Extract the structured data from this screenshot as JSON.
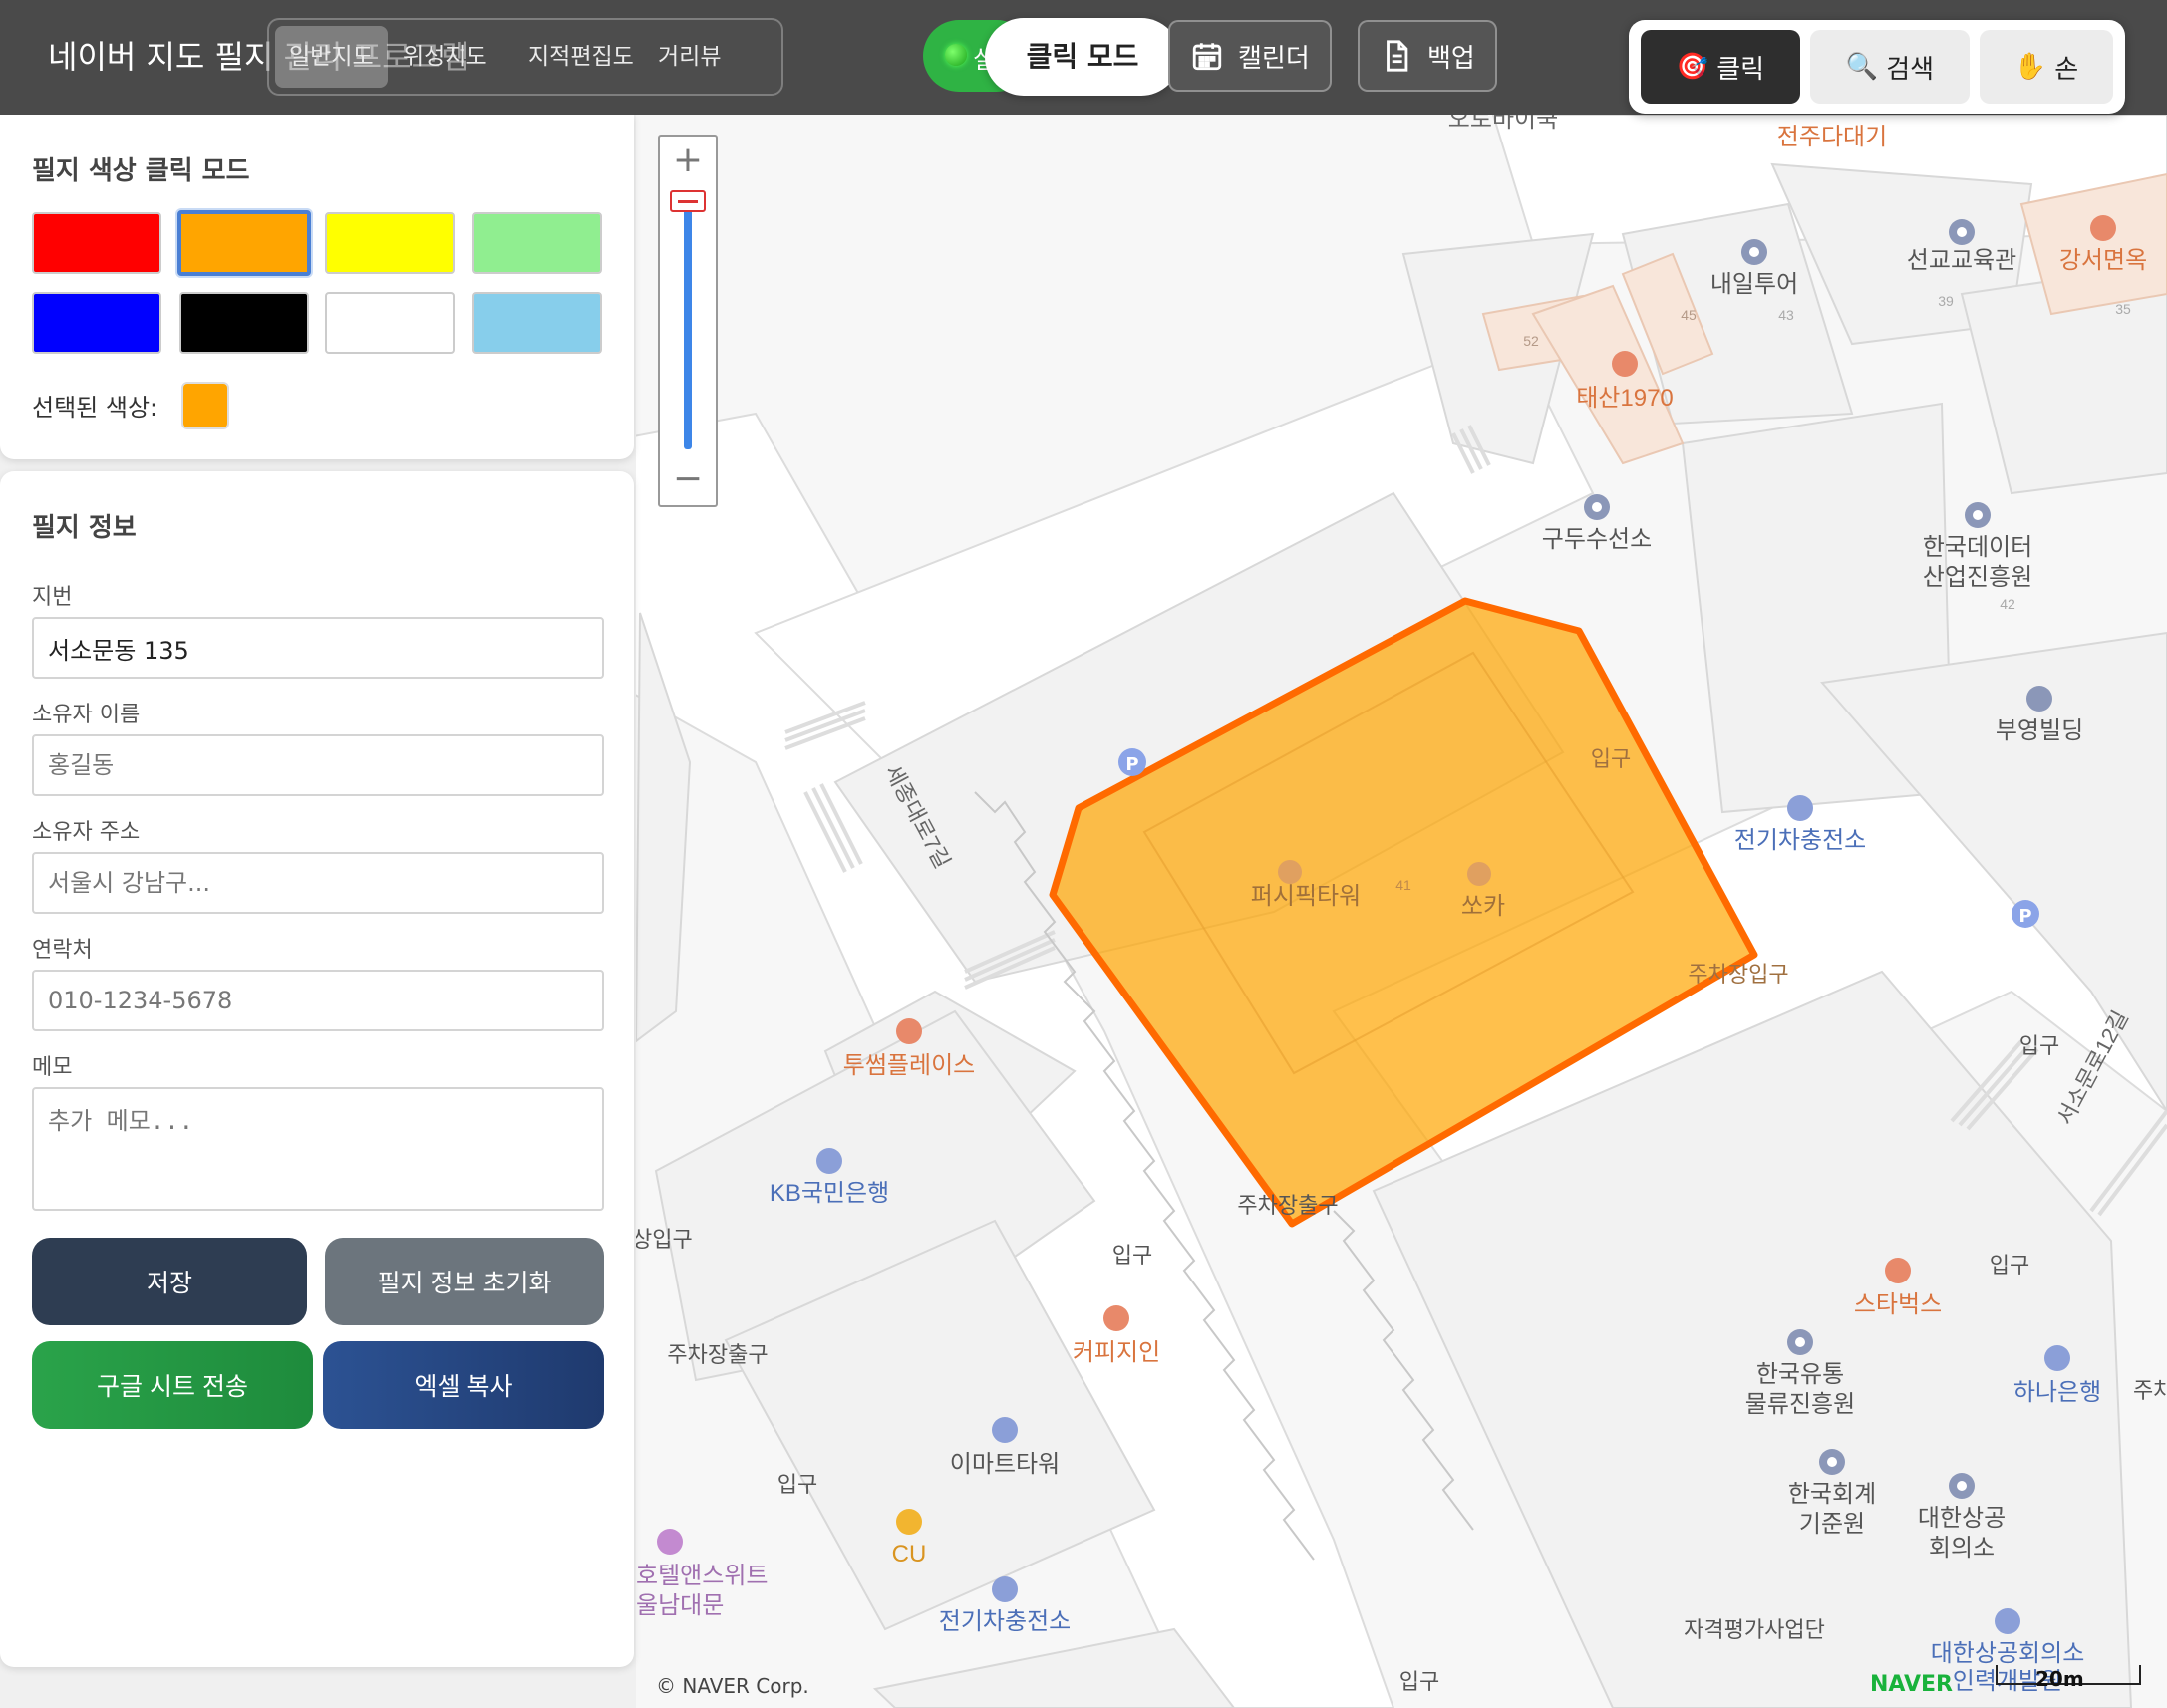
{
  "header": {
    "app_title": "네이버 지도 필지 관리 프로그램",
    "map_types": [
      {
        "label": "일반지도",
        "active": true
      },
      {
        "label": "위성지도",
        "active": false
      },
      {
        "label": "지적편집도",
        "active": false
      },
      {
        "label": "거리뷰",
        "active": false
      }
    ],
    "status_char": "실",
    "mode_label": "클릭 모드",
    "calendar_label": "캘린더",
    "backup_label": "백업",
    "tools": {
      "click": "클릭",
      "search": "검색",
      "hand": "손"
    }
  },
  "color_panel": {
    "title": "필지 색상 클릭 모드",
    "colors": [
      "#ff0000",
      "#ffa500",
      "#ffff00",
      "#90ee90",
      "#0000ff",
      "#000000",
      "#ffffff",
      "#87ceeb"
    ],
    "selected_color": "#ffa500",
    "selected_label": "선택된 색상:"
  },
  "parcel_info": {
    "title": "필지 정보",
    "fields": {
      "lot_number": {
        "label": "지번",
        "value": "서소문동 135",
        "placeholder": ""
      },
      "owner_name": {
        "label": "소유자 이름",
        "value": "",
        "placeholder": "홍길동"
      },
      "owner_address": {
        "label": "소유자 주소",
        "value": "",
        "placeholder": "서울시 강남구..."
      },
      "contact": {
        "label": "연락처",
        "value": "",
        "placeholder": "010-1234-5678"
      },
      "memo": {
        "label": "메모",
        "value": "",
        "placeholder": "추가 메모..."
      }
    },
    "buttons": {
      "save": "저장",
      "reset": "필지 정보 초기화",
      "google_sheet": "구글 시트 전송",
      "excel_copy": "엑셀 복사"
    }
  },
  "map": {
    "zoom_in": "+",
    "zoom_out": "−",
    "copyright": "© NAVER Corp.",
    "logo": "NAVER",
    "scale": "20m",
    "highlight_color": "#ffa500",
    "highlight_stroke": "#ff6a00",
    "labels": {
      "l1": "오토바이쿡",
      "l2": "전주다대기",
      "l3": "선교교육관",
      "l4": "강서면옥",
      "l5": "내일투어",
      "l6": "태산1970",
      "l7": "구두수선소",
      "l8": "한국데이터",
      "l9": "산업진흥원",
      "l10": "부영빌딩",
      "l11": "입구",
      "l12": "전기차충전소",
      "l13": "퍼시픽타워",
      "l14": "쏘카",
      "l15": "주차장입구",
      "l16": "세종대로7길",
      "l17": "입구",
      "l18": "서소문로12길",
      "l19": "투썸플레이스",
      "l20": "KB국민은행",
      "l21": "주차장출구",
      "l22": "입구",
      "l23": "주차장출구",
      "l24": "커피지인",
      "l25": "입구",
      "l26": "이마트타워",
      "l27": "CU",
      "l28": "호텔앤스위트",
      "l29": "울남대문",
      "l30": "전기차충전소",
      "l31": "스타벅스",
      "l32": "입구",
      "l33": "한국유통",
      "l34": "물류진흥원",
      "l35": "하나은행",
      "l36": "주차",
      "l37": "한국회계",
      "l38": "기준원",
      "l39": "대한상공",
      "l40": "회의소",
      "l41": "자격평가사업단",
      "l42": "대한상공회의소",
      "l43": "인력개발원",
      "l44": "입구",
      "l45": "상입구",
      "n1": "52",
      "n2": "45",
      "n3": "43",
      "n4": "39",
      "n5": "35",
      "n6": "42",
      "n7": "41"
    }
  }
}
